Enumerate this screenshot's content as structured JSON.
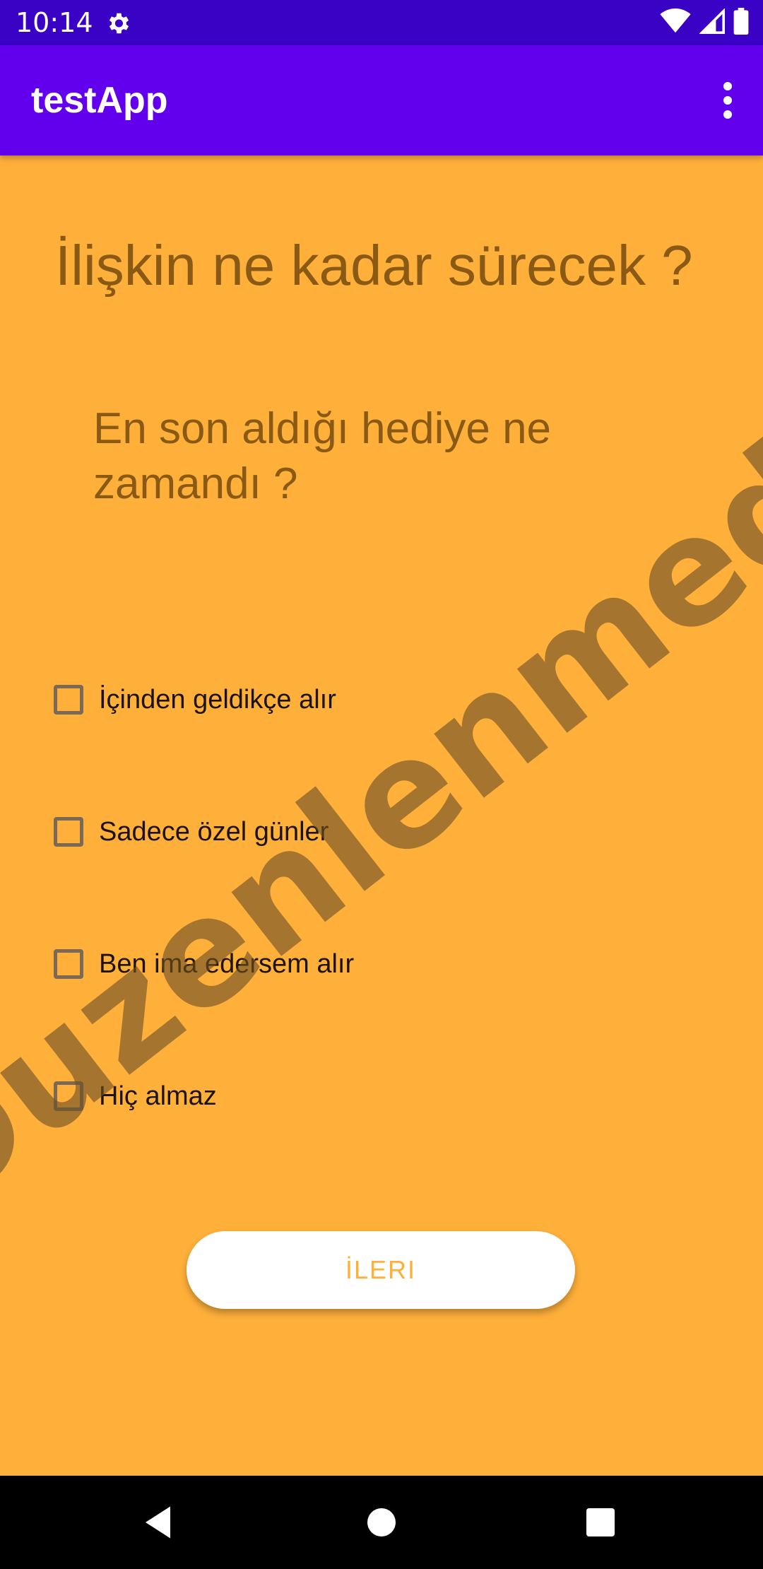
{
  "status_bar": {
    "time": "10:14",
    "icons": [
      "gear-icon",
      "wifi-icon",
      "signal-icon",
      "battery-icon"
    ]
  },
  "app_bar": {
    "title": "testApp",
    "menu_icon": "more-vert-icon"
  },
  "main": {
    "title": "İlişkin ne kadar sürecek ?",
    "question": "En son aldığı hediye ne zamandı ?",
    "options": [
      {
        "label": "İçinden geldikçe alır",
        "checked": false
      },
      {
        "label": "Sadece özel günler",
        "checked": false
      },
      {
        "label": "Ben ima edersem alır",
        "checked": false
      },
      {
        "label": "Hiç almaz",
        "checked": false
      }
    ],
    "next_button": "İLERI"
  },
  "watermark": "Duzenlenmedi",
  "colors": {
    "status_bar": "#3a02c5",
    "app_bar": "#6200ee",
    "background": "#ffb03a",
    "heading_text": "#8a5a14",
    "button_text": "#ffb03a"
  },
  "nav_bar": {
    "icons": [
      "back-icon",
      "home-icon",
      "recents-icon"
    ]
  }
}
